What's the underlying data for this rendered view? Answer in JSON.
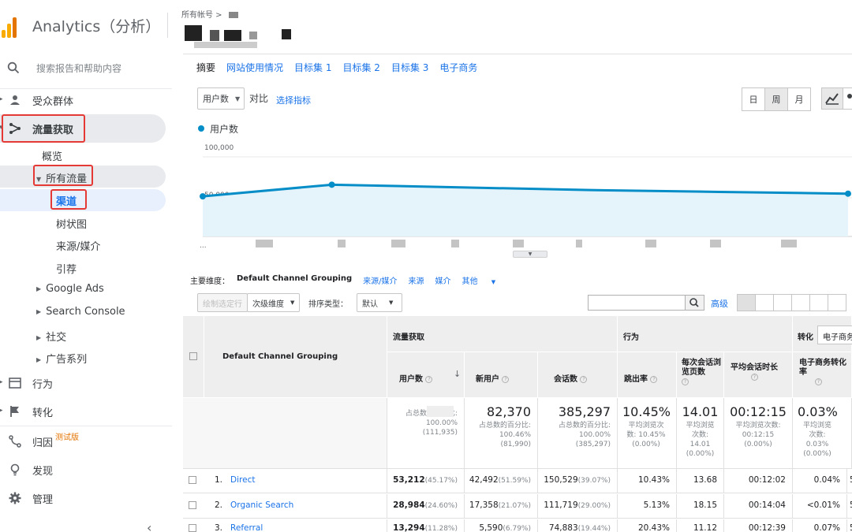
{
  "app": {
    "name": "Analytics（分析）"
  },
  "breadcrumb": "所有帐号 >",
  "sidebar": {
    "search_placeholder": "搜索报告和帮助内容",
    "audience": "受众群体",
    "acquisition": "流量获取",
    "overview": "概览",
    "all_traffic": "所有流量",
    "channels": "渠道",
    "treemap": "树状图",
    "source_medium": "来源/媒介",
    "referrals": "引荐",
    "google_ads": "Google Ads",
    "search_console": "Search Console",
    "social": "社交",
    "campaigns": "广告系列",
    "behavior": "行为",
    "conversions": "转化",
    "attribution": "归因",
    "attribution_badge": "测试版",
    "discover": "发现",
    "admin": "管理"
  },
  "tabs": [
    "摘要",
    "网站使用情况",
    "目标集 1",
    "目标集 2",
    "目标集 3",
    "电子商务"
  ],
  "chart_controls": {
    "metric": "用户数",
    "vs": "对比",
    "choose_metric": "选择指标",
    "periods": [
      "日",
      "周",
      "月"
    ],
    "active_period": "周"
  },
  "chart_data": {
    "type": "area",
    "series": [
      {
        "name": "用户数",
        "values": [
          49000,
          62000,
          59000,
          56000,
          54000,
          52000
        ]
      }
    ],
    "ylim": [
      0,
      100000
    ],
    "yticks": [
      "100,000",
      "50,000"
    ],
    "x_first_label": "...",
    "color": "#058dc7"
  },
  "dimensions": {
    "label": "主要维度：",
    "items": [
      "Default Channel Grouping",
      "来源/媒介",
      "来源",
      "媒介",
      "其他"
    ],
    "active": "Default Channel Grouping"
  },
  "toolbar": {
    "plot_rows": "绘制选定行",
    "secondary_dim": "次级维度",
    "sort_label": "排序类型：",
    "sort_value": "默认",
    "advanced": "高级"
  },
  "table": {
    "dim_header": "Default Channel Grouping",
    "groups": {
      "acquisition": "流量获取",
      "behavior": "行为",
      "conversion": "转化",
      "ecommerce": "电子商务"
    },
    "columns": [
      "用户数",
      "新用户",
      "会话数",
      "跳出率",
      "每次会话浏览页数",
      "平均会话时长",
      "电子商务转化率"
    ],
    "totals": [
      {
        "big": "",
        "sub1": "占总数的百分比:",
        "sub2": "100.00%",
        "sub3": "(111,935)"
      },
      {
        "big": "82,370",
        "sub1": "占总数的百分比:",
        "sub2": "100.46%",
        "sub3": "(81,990)"
      },
      {
        "big": "385,297",
        "sub1": "占总数的百分比:",
        "sub2": "100.00%",
        "sub3": "(385,297)"
      },
      {
        "big": "10.45%",
        "sub1": "平均浏览次",
        "sub2": "数: 10.45%",
        "sub3": "(0.00%)"
      },
      {
        "big": "14.01",
        "sub1": "平均浏览",
        "sub2": "次数:",
        "sub3": "14.01",
        "sub4": "(0.00%)"
      },
      {
        "big": "00:12:15",
        "sub1": "平均浏览次数:",
        "sub2": "00:12:15",
        "sub3": "(0.00%)"
      },
      {
        "big": "0.03%",
        "sub1": "平均浏览",
        "sub2": "次数:",
        "sub3": "0.03%",
        "sub4": "(0.00%)"
      }
    ],
    "rows": [
      {
        "rank": "1.",
        "name": "Direct",
        "users": "53,212",
        "users_pct": "(45.17%)",
        "new": "42,492",
        "new_pct": "(51.59%)",
        "sessions": "150,529",
        "sessions_pct": "(39.07%)",
        "bounce": "10.43%",
        "pages": "13.68",
        "duration": "00:12:02",
        "conv": "0.04%",
        "extra": "5"
      },
      {
        "rank": "2.",
        "name": "Organic Search",
        "users": "28,984",
        "users_pct": "(24.60%)",
        "new": "17,358",
        "new_pct": "(21.07%)",
        "sessions": "111,719",
        "sessions_pct": "(29.00%)",
        "bounce": "5.13%",
        "pages": "18.15",
        "duration": "00:14:04",
        "conv": "<0.01%",
        "extra": "5"
      },
      {
        "rank": "3.",
        "name": "Referral",
        "users": "13,294",
        "users_pct": "(11.28%)",
        "new": "5,590",
        "new_pct": "(6.79%)",
        "sessions": "74,883",
        "sessions_pct": "(19.44%)",
        "bounce": "20.43%",
        "pages": "11.12",
        "duration": "00:12:39",
        "conv": "0.07%",
        "extra": "5"
      }
    ],
    "conv_select": "电子商务"
  }
}
